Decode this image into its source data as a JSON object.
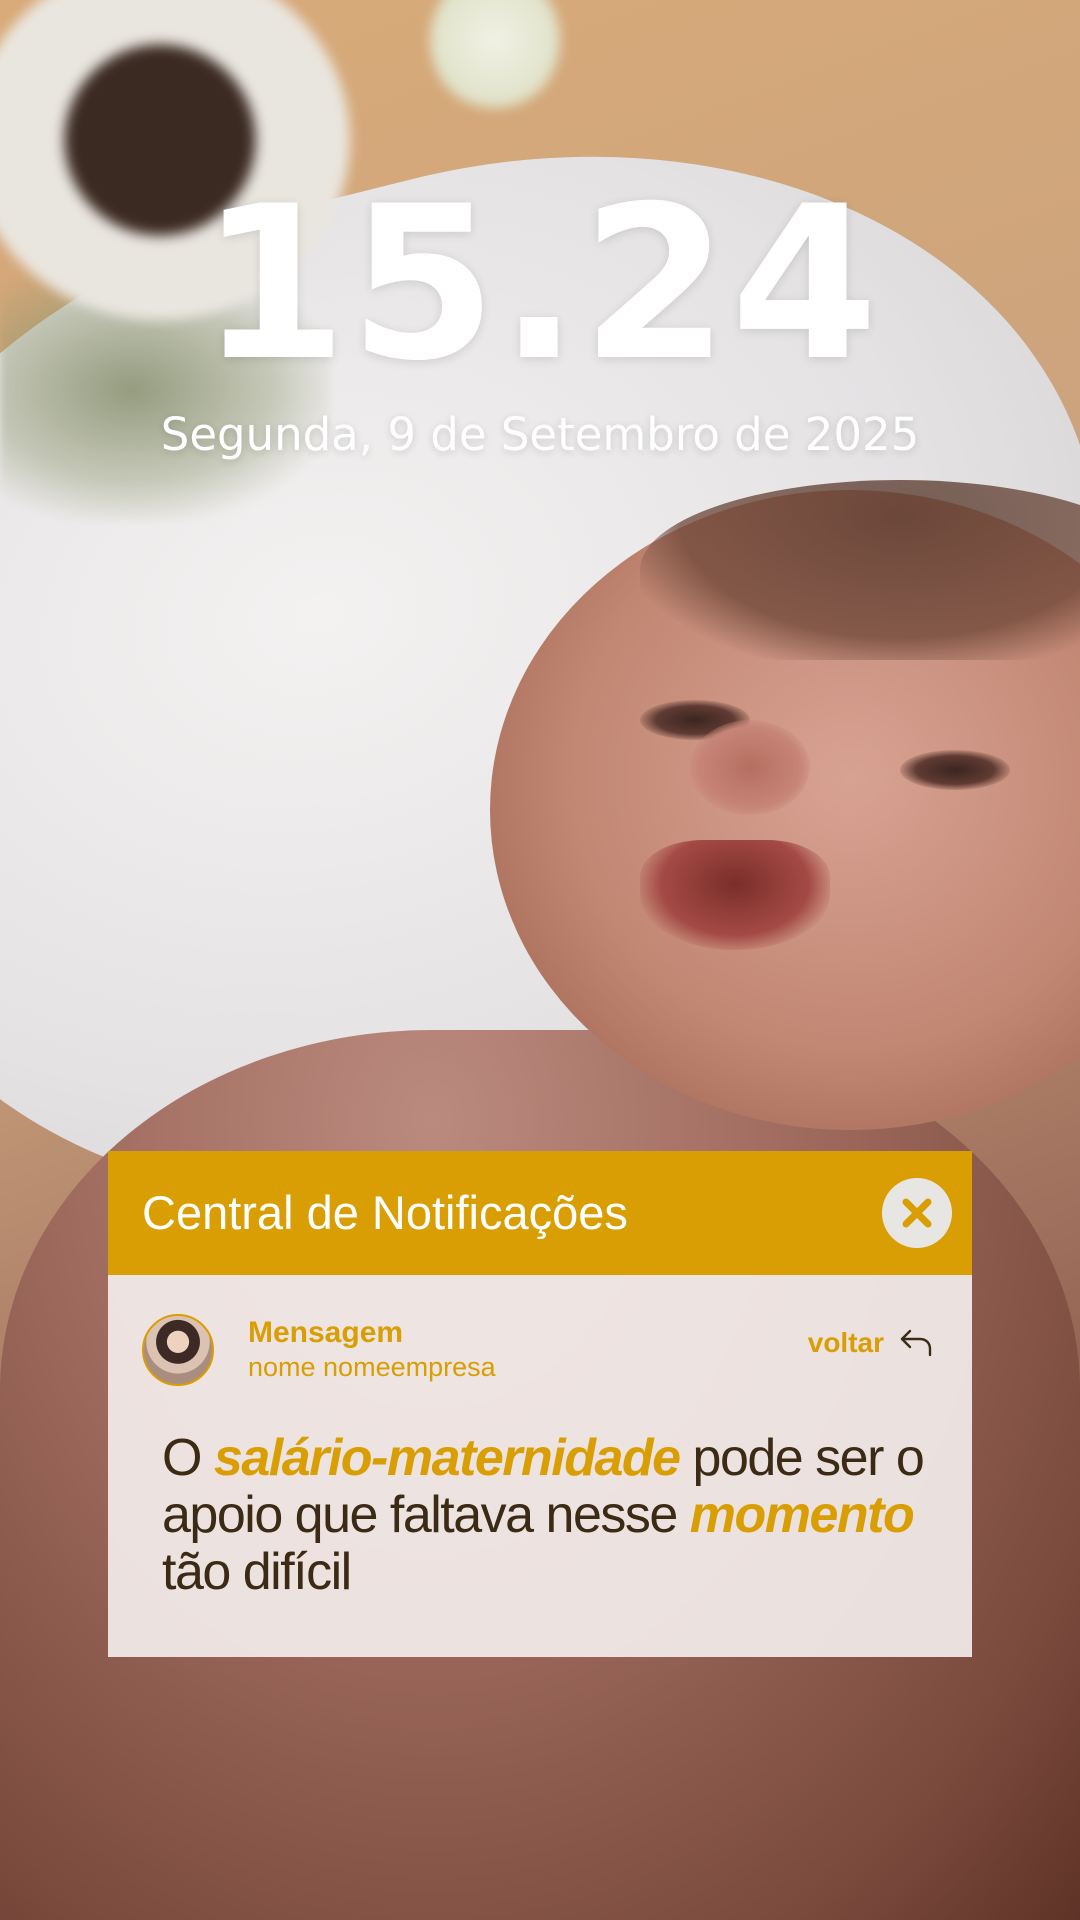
{
  "lock_screen": {
    "time": "15.24",
    "date": "Segunda, 9 de Setembro de 2025"
  },
  "notification_center": {
    "title": "Central de Notificações",
    "close_icon": "close-icon",
    "accent_color": "#d99e03",
    "notification": {
      "avatar_icon": "avatar",
      "sender": "Mensagem",
      "sender_sub": "nome nomeempresa",
      "back_label": "voltar",
      "back_icon": "reply-arrow-icon",
      "message_parts": {
        "p1": "O ",
        "p2": "salário-maternidade",
        "p3": " pode ser o apoio que faltava nesse ",
        "p4": "momento",
        "p5": " tão difícil"
      }
    }
  }
}
